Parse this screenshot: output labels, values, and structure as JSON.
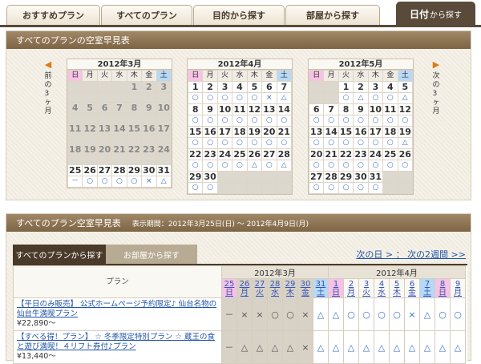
{
  "tabs": [
    "おすすめプラン",
    "すべてのプラン",
    "目的から探す",
    "部屋から探す"
  ],
  "active_tab": {
    "main": "日付",
    "suffix": "から探す"
  },
  "panel1": {
    "title": "すべてのプランの空室早見表",
    "prev_label": "前の3ヶ月",
    "next_label": "次の3ヶ月",
    "dow": [
      "日",
      "月",
      "火",
      "水",
      "木",
      "金",
      "土"
    ],
    "months": [
      {
        "title": "2012年3月",
        "past_until": 24,
        "rows": [
          [
            [
              "",
              "",
              ""
            ],
            [
              "",
              "",
              ""
            ],
            [
              "",
              "",
              ""
            ],
            [
              "",
              "",
              ""
            ],
            [
              "1",
              "",
              ""
            ],
            [
              "2",
              "",
              ""
            ],
            [
              "3",
              "",
              ""
            ]
          ],
          [
            [
              "4",
              "",
              ""
            ],
            [
              "5",
              "",
              ""
            ],
            [
              "6",
              "",
              ""
            ],
            [
              "7",
              "",
              ""
            ],
            [
              "8",
              "",
              ""
            ],
            [
              "9",
              "",
              ""
            ],
            [
              "10",
              "",
              ""
            ]
          ],
          [
            [
              "11",
              "",
              ""
            ],
            [
              "12",
              "",
              ""
            ],
            [
              "13",
              "",
              ""
            ],
            [
              "14",
              "",
              ""
            ],
            [
              "15",
              "",
              ""
            ],
            [
              "16",
              "",
              ""
            ],
            [
              "17",
              "",
              ""
            ]
          ],
          [
            [
              "18",
              "",
              ""
            ],
            [
              "19",
              "",
              ""
            ],
            [
              "20",
              "",
              ""
            ],
            [
              "21",
              "",
              ""
            ],
            [
              "22",
              "",
              ""
            ],
            [
              "23",
              "",
              ""
            ],
            [
              "24",
              "",
              ""
            ]
          ],
          [
            [
              "25",
              "－",
              ""
            ],
            [
              "26",
              "○",
              ""
            ],
            [
              "27",
              "○",
              ""
            ],
            [
              "28",
              "○",
              ""
            ],
            [
              "29",
              "○",
              ""
            ],
            [
              "30",
              "×",
              ""
            ],
            [
              "31",
              "△",
              ""
            ]
          ]
        ]
      },
      {
        "title": "2012年4月",
        "rows": [
          [
            [
              "1",
              "○"
            ],
            [
              "2",
              "○"
            ],
            [
              "3",
              "○"
            ],
            [
              "4",
              "○"
            ],
            [
              "5",
              "○"
            ],
            [
              "6",
              "×"
            ],
            [
              "7",
              "△"
            ]
          ],
          [
            [
              "8",
              "○"
            ],
            [
              "9",
              "○"
            ],
            [
              "10",
              "○"
            ],
            [
              "11",
              "○"
            ],
            [
              "12",
              "○"
            ],
            [
              "13",
              "○"
            ],
            [
              "14",
              "○"
            ]
          ],
          [
            [
              "15",
              "○"
            ],
            [
              "16",
              "○"
            ],
            [
              "17",
              "○"
            ],
            [
              "18",
              "○"
            ],
            [
              "19",
              "○"
            ],
            [
              "20",
              "○"
            ],
            [
              "21",
              "○"
            ]
          ],
          [
            [
              "22",
              "○"
            ],
            [
              "23",
              "○"
            ],
            [
              "24",
              "○"
            ],
            [
              "25",
              "○"
            ],
            [
              "26",
              "△"
            ],
            [
              "27",
              "○"
            ],
            [
              "28",
              "△"
            ]
          ],
          [
            [
              "29",
              "○"
            ],
            [
              "30",
              "○"
            ],
            [
              "",
              ""
            ],
            [
              "",
              ""
            ],
            [
              "",
              ""
            ],
            [
              "",
              ""
            ],
            [
              "",
              ""
            ]
          ]
        ]
      },
      {
        "title": "2012年5月",
        "rows": [
          [
            [
              "",
              ""
            ],
            [
              "",
              ""
            ],
            [
              "1",
              "○"
            ],
            [
              "2",
              "△"
            ],
            [
              "3",
              "○"
            ],
            [
              "4",
              "○"
            ],
            [
              "5",
              "△"
            ]
          ],
          [
            [
              "6",
              "○"
            ],
            [
              "7",
              "○"
            ],
            [
              "8",
              "○"
            ],
            [
              "9",
              "○"
            ],
            [
              "10",
              "○"
            ],
            [
              "11",
              "○"
            ],
            [
              "12",
              "○"
            ]
          ],
          [
            [
              "13",
              "○"
            ],
            [
              "14",
              "○"
            ],
            [
              "15",
              "○"
            ],
            [
              "16",
              "○"
            ],
            [
              "17",
              "○"
            ],
            [
              "18",
              "○"
            ],
            [
              "19",
              "△"
            ]
          ],
          [
            [
              "20",
              "○"
            ],
            [
              "21",
              "○"
            ],
            [
              "22",
              "○"
            ],
            [
              "23",
              "○"
            ],
            [
              "24",
              "○"
            ],
            [
              "25",
              "○"
            ],
            [
              "26",
              "○"
            ]
          ],
          [
            [
              "27",
              "○"
            ],
            [
              "28",
              "○"
            ],
            [
              "29",
              "○"
            ],
            [
              "30",
              "○"
            ],
            [
              "31",
              "○"
            ],
            [
              "",
              ""
            ],
            [
              "",
              ""
            ]
          ]
        ]
      }
    ]
  },
  "panel2": {
    "title": "すべてのプラン空室早見表",
    "period": "表示期間：2012年3月25日(日) ～ 2012年4月9日(月)",
    "tab_all": "すべてのプランから探す",
    "tab_room": "お部屋から探す",
    "link_next_day": "次の日 >",
    "link_next_2w": "次の2週間 >>",
    "plan_header": "プラン",
    "month_mar": "2012年3月",
    "month_apr": "2012年4月",
    "days": [
      {
        "d": "25",
        "w": "日",
        "t": "sun"
      },
      {
        "d": "26",
        "w": "月",
        "t": "past"
      },
      {
        "d": "27",
        "w": "火",
        "t": "past"
      },
      {
        "d": "28",
        "w": "水",
        "t": "past"
      },
      {
        "d": "29",
        "w": "木",
        "t": "past"
      },
      {
        "d": "30",
        "w": "金",
        "t": "past"
      },
      {
        "d": "31",
        "w": "土",
        "t": "sat"
      },
      {
        "d": "1",
        "w": "日",
        "t": "sun"
      },
      {
        "d": "2",
        "w": "月",
        "t": ""
      },
      {
        "d": "3",
        "w": "火",
        "t": ""
      },
      {
        "d": "4",
        "w": "水",
        "t": ""
      },
      {
        "d": "5",
        "w": "木",
        "t": ""
      },
      {
        "d": "6",
        "w": "金",
        "t": ""
      },
      {
        "d": "7",
        "w": "土",
        "t": "sat"
      },
      {
        "d": "8",
        "w": "日",
        "t": "sun"
      },
      {
        "d": "9",
        "w": "月",
        "t": ""
      }
    ],
    "plans": [
      {
        "name": "【平日のみ販売】 公式ホームページ予約限定♪ 仙台名物の仙台牛満喫プラン",
        "price": "¥22,890～",
        "marks": [
          "－",
          "×",
          "×",
          "○",
          "○",
          "×",
          "△",
          "△",
          "○",
          "○",
          "○",
          "○",
          "×",
          "△",
          "○",
          "○"
        ]
      },
      {
        "name": "【すべる得！プラン】 ☆ 冬季限定特別プラン ☆ 蔵王の食と遊び満喫！４リフト券付♪プラン",
        "price": "¥13,440～",
        "marks": [
          "－",
          "△",
          "△",
          "△",
          "△",
          "×",
          "△",
          "△",
          "△",
          "△",
          "△",
          "△",
          "△",
          "△",
          "△",
          "△"
        ]
      }
    ]
  }
}
